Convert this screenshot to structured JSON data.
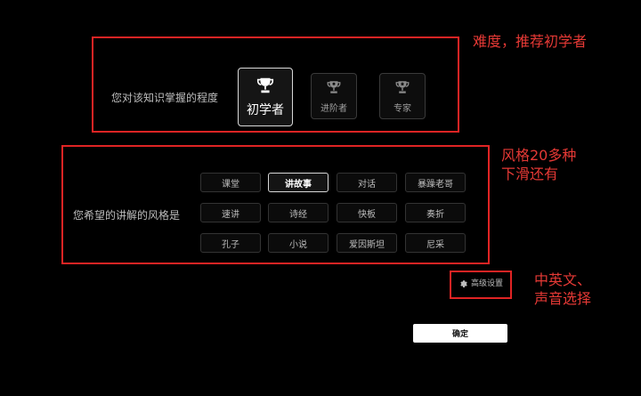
{
  "difficulty": {
    "question": "您对该知识掌握的程度",
    "levels": [
      {
        "label": "初学者",
        "icon": "trophy-icon",
        "selected": true
      },
      {
        "label": "进阶者",
        "icon": "trophy-icon",
        "selected": false
      },
      {
        "label": "专家",
        "icon": "trophy-icon",
        "selected": false
      }
    ]
  },
  "style": {
    "question": "您希望的讲解的风格是",
    "options": [
      "课堂",
      "讲故事",
      "对话",
      "暴躁老哥",
      "速讲",
      "诗经",
      "快板",
      "奏折",
      "孔子",
      "小说",
      "爱因斯坦",
      "尼采"
    ],
    "selected": "讲故事"
  },
  "advanced": {
    "label": "高级设置",
    "icon": "gear-icon"
  },
  "confirm": {
    "label": "确定"
  },
  "annotations": {
    "difficulty_note": "难度，推荐初学者",
    "style_note": "风格20多种\n下滑还有",
    "advanced_note": "中英文、\n声音选择"
  },
  "colors": {
    "annotation": "#e53935",
    "background": "#000000",
    "selected_border": "#d8d8d8"
  }
}
